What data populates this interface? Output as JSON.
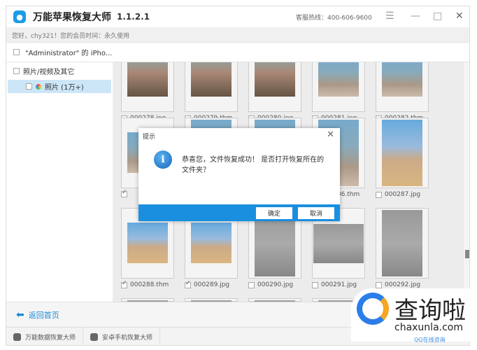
{
  "app": {
    "title": "万能苹果恢复大师",
    "version": "1.1.2.1",
    "hotline": "客服热线：400-606-9600",
    "greeting": "您好，chy321！您的会员时间：永久使用",
    "brand_color": "#1a9be8"
  },
  "device": {
    "label": "\"Administrator\" 的 iPho..."
  },
  "sidebar": {
    "items": [
      {
        "label": "照片/视频及其它"
      },
      {
        "label": "照片 (1万+)",
        "selected": true
      }
    ]
  },
  "grid": {
    "rows": [
      [
        {
          "name": "000278.jpg",
          "checked": false
        },
        {
          "name": "000279.thm",
          "checked": false
        },
        {
          "name": "000280.jpg",
          "checked": false
        },
        {
          "name": "000281.jpg",
          "checked": false
        },
        {
          "name": "000282.thm",
          "checked": false
        }
      ],
      [
        {
          "name": "",
          "checked": true
        },
        {
          "name": "",
          "checked": false
        },
        {
          "name": "",
          "checked": false
        },
        {
          "name": "000286.thm",
          "checked": false
        },
        {
          "name": "000287.jpg",
          "checked": false
        }
      ],
      [
        {
          "name": "000288.thm",
          "checked": true
        },
        {
          "name": "000289.jpg",
          "checked": true
        },
        {
          "name": "000290.jpg",
          "checked": false
        },
        {
          "name": "000291.jpg",
          "checked": false
        },
        {
          "name": "000292.jpg",
          "checked": false
        }
      ]
    ]
  },
  "dialog": {
    "title": "提示",
    "message": "恭喜您，文件恢复成功！ 是否打开恢复所在的文件夹？",
    "ok": "确定",
    "cancel": "取消",
    "footer_color": "#1a8fe0"
  },
  "bottom": {
    "back": "返回首页"
  },
  "footer": {
    "tabs": [
      "万能数据恢复大师",
      "安卓手机恢复大师"
    ],
    "qq": "QQ在线咨询"
  },
  "watermark": {
    "text": "查询啦",
    "url": "chaxunla.com"
  }
}
